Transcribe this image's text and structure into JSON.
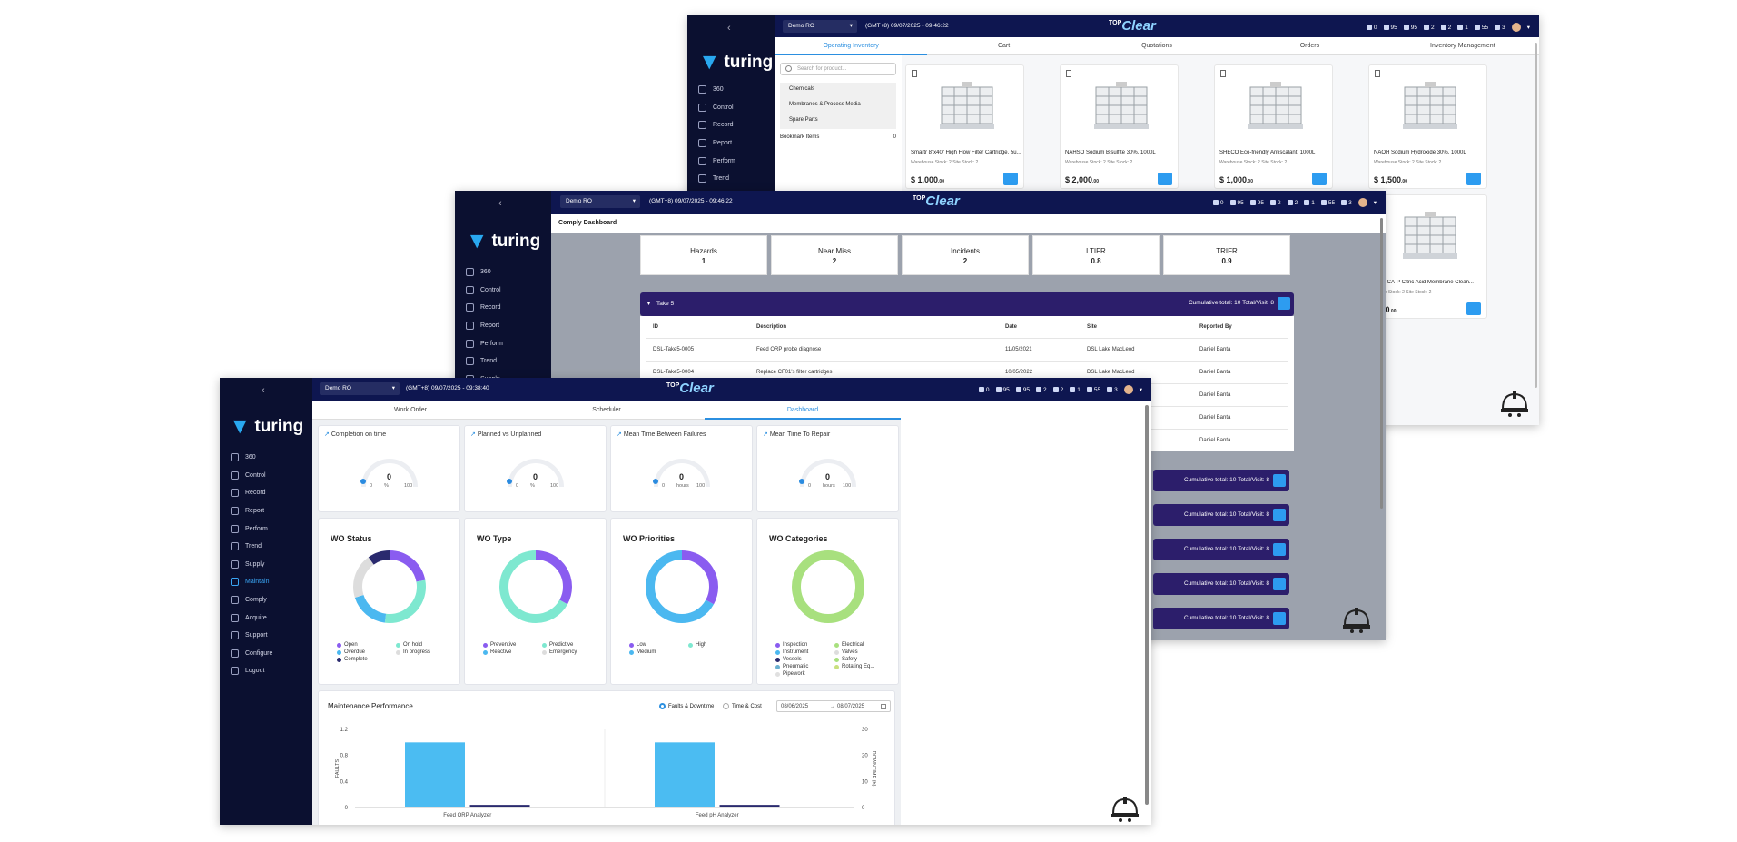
{
  "brand": {
    "top": "TOP",
    "clear": "Clear"
  },
  "sidebar": {
    "logo": "turing",
    "collapse_icon": "chevron-left-icon"
  },
  "badges": [
    "0",
    "95",
    "95",
    "2",
    "2",
    "1",
    "55",
    "3"
  ],
  "win1": {
    "site": "Demo RO",
    "clock": "(GMT+8) 09/07/2025 - 09:46:22",
    "nav": [
      "360",
      "Control",
      "Record",
      "Report",
      "Perform",
      "Trend",
      "Supply"
    ],
    "tabs": [
      "Operating Inventory",
      "Cart",
      "Quotations",
      "Orders",
      "Inventory Management"
    ],
    "search_placeholder": "Search for product...",
    "categories": [
      "Chemicals",
      "Membranes & Process Media",
      "Spare Parts"
    ],
    "bookmark": "Bookmark Items",
    "bookmark_count": "0",
    "products": [
      {
        "name": "Smartr 8\"x40\" High Flow Filter Cartridge, 5u...",
        "stock": "Warehouse Stock: 2   Site Stock: 2",
        "price": "$ 1,000",
        "cents": ".00"
      },
      {
        "name": "NAHSO Sodium Bisulfite 30%, 1000L",
        "stock": "Warehouse Stock: 2   Site Stock: 2",
        "price": "$ 2,000",
        "cents": ".00"
      },
      {
        "name": "SHECO Eco-friendly Antiscalant, 1000L",
        "stock": "Warehouse Stock: 2   Site Stock: 2",
        "price": "$ 1,000",
        "cents": ".00"
      },
      {
        "name": "NAOH Sodium Hydroxide 30%, 1000L",
        "stock": "Warehouse Stock: 2   Site Stock: 2",
        "price": "$ 1,500",
        "cents": ".00"
      },
      {
        "name": "ECO CA-P Citric Acid Membrane Clean...",
        "stock": "House Stock: 2   Site Stock: 2",
        "price": ",500",
        "cents": ".00"
      }
    ]
  },
  "win2": {
    "site": "Demo RO",
    "clock": "(GMT+8) 09/07/2025 - 09:46:22",
    "nav": [
      "360",
      "Control",
      "Record",
      "Report",
      "Perform",
      "Trend",
      "Supply"
    ],
    "title": "Comply Dashboard",
    "kpis": [
      {
        "label": "Hazards",
        "value": "1"
      },
      {
        "label": "Near Miss",
        "value": "2"
      },
      {
        "label": "Incidents",
        "value": "2"
      },
      {
        "label": "LTIFR",
        "value": "0.8"
      },
      {
        "label": "TRIFR",
        "value": "0.9"
      }
    ],
    "section": "Take 5",
    "cumulative": "Cumulative total: 10  Total/Visit: 8",
    "columns": [
      "ID",
      "Description",
      "Date",
      "Site",
      "Reported By"
    ],
    "rows": [
      [
        "DSL-Take5-0005",
        "Feed ORP probe diagnose",
        "11/05/2021",
        "DSL Lake MacLeod",
        "Daniel Banta"
      ],
      [
        "DSL-Take5-0004",
        "Replace CF01's filter cartridges",
        "10/05/2022",
        "DSL Lake MacLeod",
        "Daniel Banta"
      ],
      [
        "",
        "",
        "",
        "",
        "Daniel Banta"
      ],
      [
        "",
        "",
        "",
        "",
        "Daniel Banta"
      ],
      [
        "",
        "",
        "",
        "",
        "Daniel Banta"
      ]
    ]
  },
  "win3": {
    "site": "Demo RO",
    "clock": "(GMT+8) 09/07/2025 - 09:38:40",
    "nav": [
      "360",
      "Control",
      "Record",
      "Report",
      "Perform",
      "Trend",
      "Supply",
      "Maintain",
      "Comply",
      "Acquire",
      "Support",
      "Configure",
      "Logout"
    ],
    "tabs": [
      "Work Order",
      "Scheduler",
      "Dashboard"
    ],
    "gauges": [
      {
        "title": "Completion on time",
        "value": "0",
        "unit": "%",
        "min": "0",
        "max": "100"
      },
      {
        "title": "Planned vs Unplanned",
        "value": "0",
        "unit": "%",
        "min": "0",
        "max": "100"
      },
      {
        "title": "Mean Time Between Failures",
        "value": "0",
        "unit": "hours",
        "min": "0",
        "max": "100"
      },
      {
        "title": "Mean Time To Repair",
        "value": "0",
        "unit": "hours",
        "min": "0",
        "max": "100"
      }
    ],
    "donuts": [
      {
        "title": "WO Status",
        "legend": [
          [
            "Open",
            "#8a5cf0"
          ],
          [
            "On hold",
            "#7ee8d0"
          ],
          [
            "Overdue",
            "#4bb8f0"
          ],
          [
            "In progress",
            "#dddddd"
          ],
          [
            "Complete",
            "#2a2a6e"
          ]
        ]
      },
      {
        "title": "WO Type",
        "legend": [
          [
            "Preventive",
            "#8a5cf0"
          ],
          [
            "Predictive",
            "#7ee8d0"
          ],
          [
            "Reactive",
            "#4bb8f0"
          ],
          [
            "Emergency",
            "#dddddd"
          ]
        ]
      },
      {
        "title": "WO Priorities",
        "legend": [
          [
            "Low",
            "#8a5cf0"
          ],
          [
            "High",
            "#7ee8d0"
          ],
          [
            "Medium",
            "#4bb8f0"
          ]
        ]
      },
      {
        "title": "WO Categories",
        "legend": [
          [
            "Inspection",
            "#8a5cf0"
          ],
          [
            "Electrical",
            "#a8e07e"
          ],
          [
            "Instrument",
            "#4bb8f0"
          ],
          [
            "Valves",
            "#dddddd"
          ],
          [
            "Vessels",
            "#2a2a6e"
          ],
          [
            "Safety",
            "#a8e07e"
          ],
          [
            "Pneumatic",
            "#6ab0d0"
          ],
          [
            "Rotating Eq...",
            "#c9e07e"
          ],
          [
            "Pipework",
            "#e0e0e0"
          ]
        ]
      }
    ],
    "perf": {
      "title": "Maintenance Performance",
      "opt1": "Faults & Downtime",
      "opt2": "Time & Cost",
      "date_from": "08/06/2025",
      "date_to": "08/07/2025",
      "yleft": "FAULTS",
      "yright": "DOWNTIME (h)",
      "legend1": "FAULTS",
      "legend2": "DOWNTIME"
    }
  },
  "chart_data": {
    "type": "bar",
    "categories": [
      "Feed ORP Analyzer",
      "Feed pH Analyzer"
    ],
    "series": [
      {
        "name": "FAULTS",
        "values": [
          1,
          1
        ]
      },
      {
        "name": "DOWNTIME",
        "values": [
          1,
          1
        ]
      }
    ],
    "ylabel": "FAULTS",
    "ylim": [
      0,
      1.2
    ],
    "yticks": [
      "0",
      "0.4",
      "0.8",
      "1.2"
    ],
    "y2label": "DOWNTIME (h)",
    "y2lim": [
      0,
      30
    ],
    "y2ticks": [
      "0",
      "10",
      "20",
      "30"
    ]
  }
}
